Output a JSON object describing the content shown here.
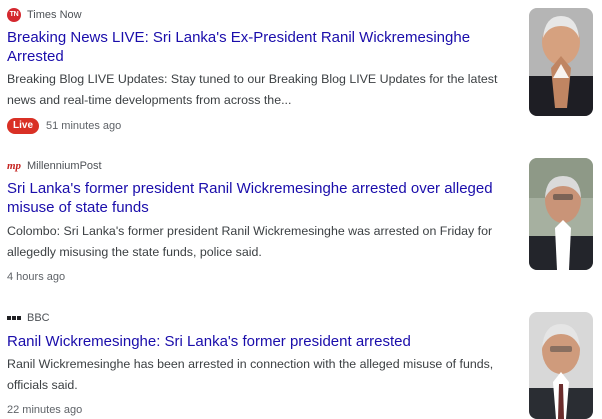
{
  "articles": [
    {
      "source": "Times Now",
      "source_icon": "times-now-logo-icon",
      "title": "Breaking News LIVE: Sri Lanka's Ex-President Ranil Wickremesinghe Arrested",
      "snippet": "Breaking Blog LIVE Updates: Stay tuned to our Breaking Blog LIVE Updates for the latest news and real-time developments from across the...",
      "badge": "Live",
      "time": "51 minutes ago"
    },
    {
      "source": "MillenniumPost",
      "source_icon": "millennium-post-logo-icon",
      "title": "Sri Lanka's former president Ranil Wickremesinghe arrested over alleged misuse of state funds",
      "snippet": "Colombo: Sri Lanka's former president Ranil Wickremesinghe was arrested on Friday for allegedly misusing the state funds, police said.",
      "time": "4 hours ago"
    },
    {
      "source": "BBC",
      "source_icon": "bbc-logo-icon",
      "title": "Ranil Wickremesinghe: Sri Lanka's former president arrested",
      "snippet": "Ranil Wickremesinghe has been arrested in connection with the alleged misuse of funds, officials said.",
      "time": "22 minutes ago"
    }
  ],
  "logo_texts": {
    "times_now": "TN",
    "millennium_post": "mp"
  },
  "colors": {
    "title_link": "#1a0dab",
    "live_badge": "#d93025",
    "times_now_brand": "#d4282f"
  }
}
